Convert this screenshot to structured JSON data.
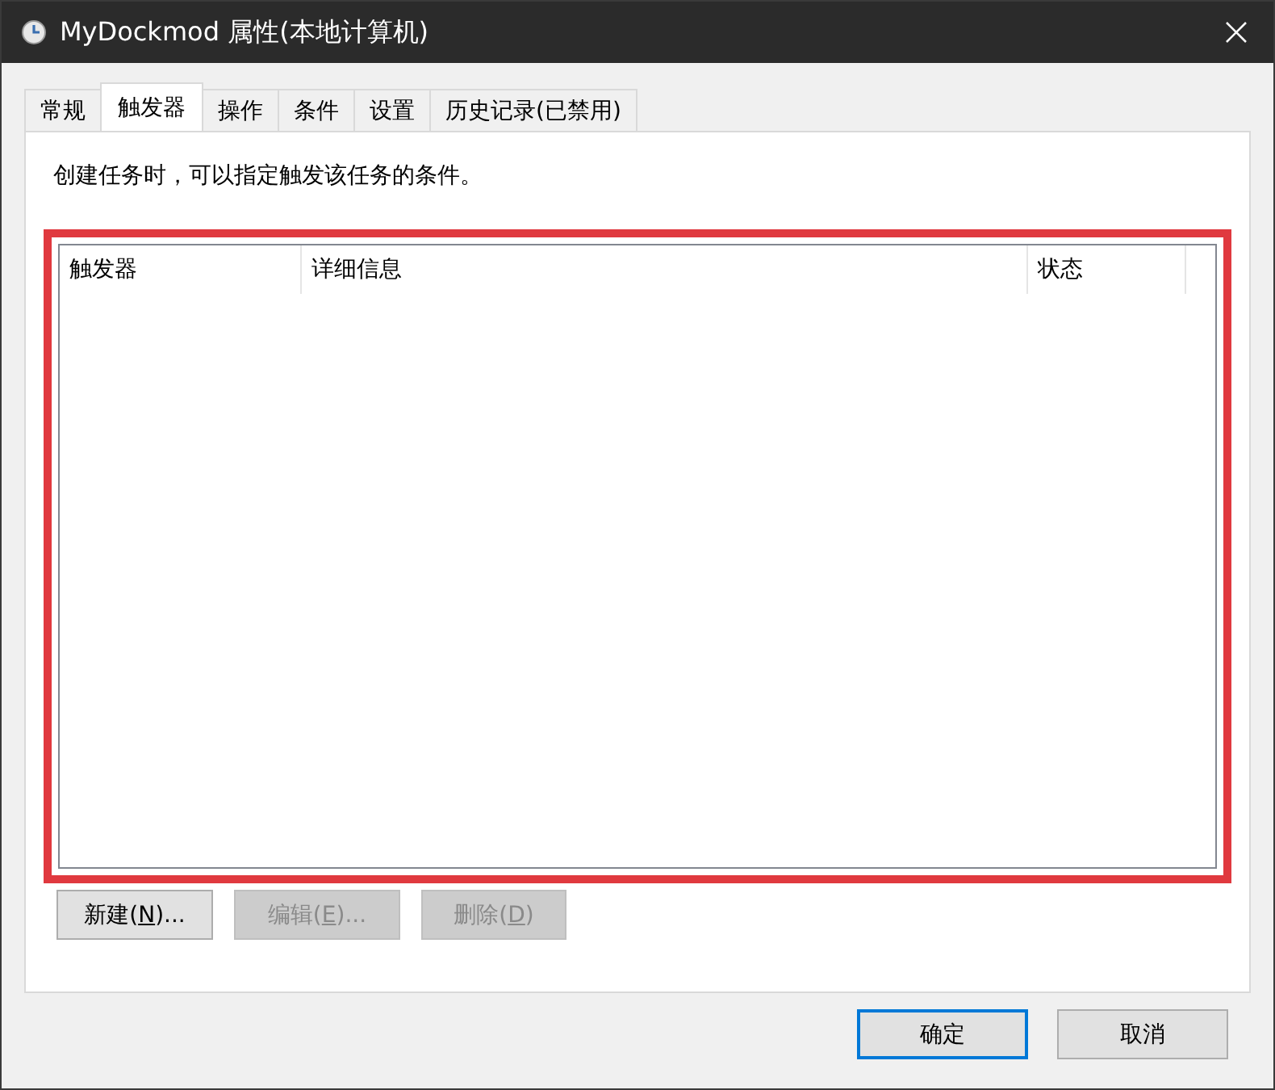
{
  "window": {
    "title": "MyDockmod 属性(本地计算机)"
  },
  "tabs": [
    {
      "label": "常规",
      "selected": false
    },
    {
      "label": "触发器",
      "selected": true
    },
    {
      "label": "操作",
      "selected": false
    },
    {
      "label": "条件",
      "selected": false
    },
    {
      "label": "设置",
      "selected": false
    },
    {
      "label": "历史记录(已禁用)",
      "selected": false
    }
  ],
  "description": "创建任务时，可以指定触发该任务的条件。",
  "list": {
    "columns": [
      "触发器",
      "详细信息",
      "状态"
    ]
  },
  "list_buttons": [
    {
      "before": "新建(",
      "key": "N",
      "after": ")...",
      "disabled": false
    },
    {
      "before": "编辑(",
      "key": "E",
      "after": ")...",
      "disabled": true
    },
    {
      "before": "删除(",
      "key": "D",
      "after": ")",
      "disabled": true
    }
  ],
  "dialog_buttons": [
    {
      "label": "确定",
      "default": true
    },
    {
      "label": "取消",
      "default": false
    }
  ]
}
